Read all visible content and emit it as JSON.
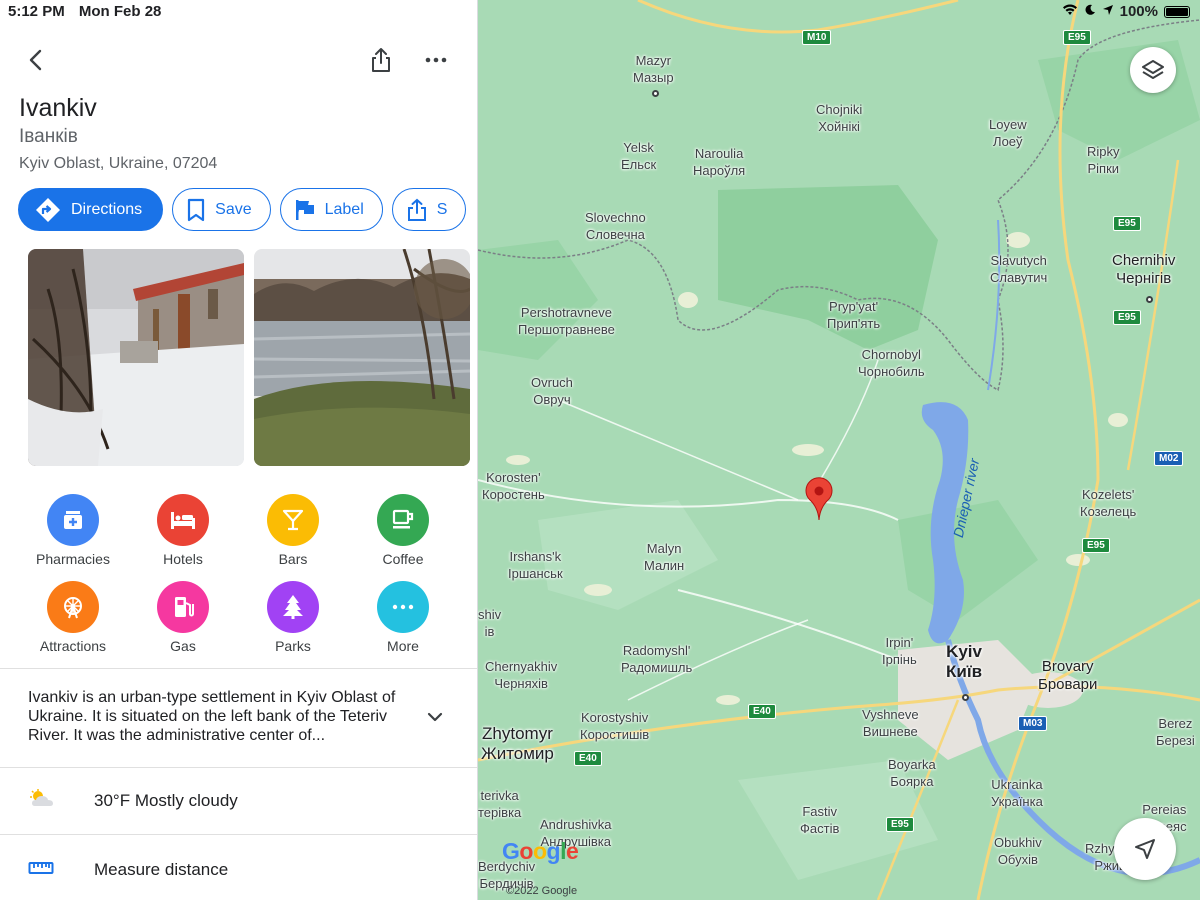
{
  "status": {
    "time": "5:12 PM",
    "date": "Mon Feb 28",
    "battery": "100%"
  },
  "place": {
    "title": "Ivankiv",
    "subtitle": "Іванків",
    "address": "Kyiv Oblast, Ukraine, 07204"
  },
  "actions": {
    "directions": "Directions",
    "save": "Save",
    "label": "Label",
    "share": "S"
  },
  "categories": [
    {
      "label": "Pharmacies",
      "color": "#4285f4",
      "icon": "pharmacy-icon"
    },
    {
      "label": "Hotels",
      "color": "#ea4335",
      "icon": "bed-icon"
    },
    {
      "label": "Bars",
      "color": "#fbbc04",
      "icon": "cocktail-icon"
    },
    {
      "label": "Coffee",
      "color": "#34a853",
      "icon": "coffee-cup-icon"
    },
    {
      "label": "Attractions",
      "color": "#fa7b17",
      "icon": "ferris-wheel-icon"
    },
    {
      "label": "Gas",
      "color": "#f538a0",
      "icon": "gas-pump-icon"
    },
    {
      "label": "Parks",
      "color": "#a142f4",
      "icon": "tree-icon"
    },
    {
      "label": "More",
      "color": "#24c1e0",
      "icon": "more-dots-icon"
    }
  ],
  "description": "Ivankiv is an urban-type settlement in Kyiv Oblast of Ukraine. It is situated on the left bank of the Teteriv River. It was the administrative center of...",
  "weather": {
    "text": "30°F Mostly cloudy",
    "icon": "partly-cloudy-icon"
  },
  "measure": {
    "text": "Measure distance",
    "icon": "ruler-icon"
  },
  "map": {
    "places": {
      "mazyr": "Mazyr",
      "mazyr_local": "Мазыр",
      "yelsk": "Yelsk",
      "yelsk_local": "Ельск",
      "naroulia": "Naroulia",
      "naroulia_local": "Нароўля",
      "chojniki": "Chojniki",
      "chojniki_local": "Хойнікі",
      "loyew": "Loyew",
      "loyew_local": "Лоеў",
      "ripky": "Ripky",
      "ripky_local": "Ріпки",
      "slovechno": "Slovechno",
      "slovechno_local": "Словечна",
      "slavutych": "Slavutych",
      "slavutych_local": "Славутич",
      "chernihiv": "Chernihiv",
      "chernihiv_local": "Чернігів",
      "pershotravneve": "Pershotravneve",
      "pershotravneve_local": "Першотравневе",
      "prypyat": "Pryp'yat'",
      "prypyat_local": "Прип'ять",
      "chornobyl": "Chornobyl",
      "chornobyl_local": "Чорнобиль",
      "ovruch": "Ovruch",
      "ovruch_local": "Овруч",
      "korosten": "Korosten'",
      "korosten_local": "Коростень",
      "kozelets": "Kozelets'",
      "kozelets_local": "Козелець",
      "irshansk": "Irshans'k",
      "irshansk_local": "Іршанськ",
      "malyn": "Malyn",
      "malyn_local": "Малин",
      "shiv": "shiv",
      "shiv_local": "ів",
      "radomyshl": "Radomyshl'",
      "radomyshl_local": "Радомишль",
      "irpin": "Irpin'",
      "irpin_local": "Ірпінь",
      "kyiv": "Kyiv",
      "kyiv_local": "Київ",
      "brovary": "Brovary",
      "brovary_local": "Бровари",
      "chernyakhiv": "Chernyakhiv",
      "chernyakhiv_local": "Черняхів",
      "zhytomyr": "Zhytomyr",
      "zhytomyr_local": "Житомир",
      "korostyshiv": "Korostyshiv",
      "korostyshiv_local": "Коростишів",
      "vyshneve": "Vyshneve",
      "vyshneve_local": "Вишневе",
      "berez": "Berez",
      "berez_local": "Березі",
      "boyarka": "Boyarka",
      "boyarka_local": "Боярка",
      "terivka": "terivka",
      "terivka_local": "терівка",
      "ukrainka": "Ukrainka",
      "ukrainka_local": "Українка",
      "pereias": "Pereias",
      "pereias_local": "Переяс",
      "fastiv": "Fastiv",
      "fastiv_local": "Фастів",
      "andrushivka": "Andrushivka",
      "andrushivka_local": "Андрушівка",
      "obukhiv": "Obukhiv",
      "obukhiv_local": "Обухів",
      "rzhyshchiv": "Rzhyshch",
      "rzhyshchiv_local": "Ржищі",
      "berdychiv": "Berdychiv",
      "berdychiv_local": "Бердичів"
    },
    "river": "Dnieper river",
    "roads": [
      "M10",
      "E95",
      "E95",
      "E95",
      "E95",
      "M02",
      "E40",
      "E40",
      "M03",
      "E95"
    ],
    "google": "Google",
    "copyright": "©2022 Google"
  }
}
